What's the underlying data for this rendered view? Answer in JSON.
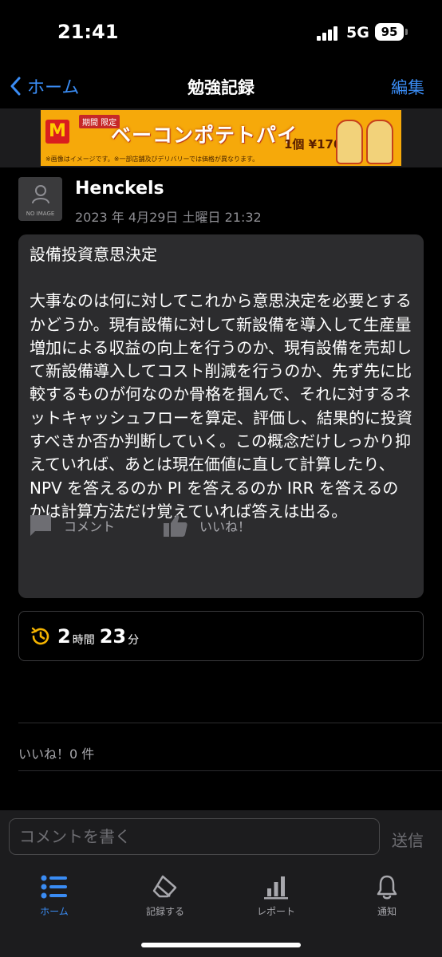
{
  "status_bar": {
    "time": "21:41",
    "network": "5G",
    "battery": "95"
  },
  "nav": {
    "back_label": "ホーム",
    "title": "勉強記録",
    "edit_label": "編集"
  },
  "ad": {
    "brand_mark": "M",
    "tag": "期間 限定",
    "title": "ベーコンポテトパイ",
    "price": "1個 ¥170~",
    "note": "※画像はイメージです。※一部店舗及びデリバリーでは価格が異なります。"
  },
  "post": {
    "avatar_text": "NO IMAGE",
    "username": "Henckels",
    "date": "2023 年 4月29日 土曜日 21:32",
    "title": "設備投資意思決定",
    "body": "大事なのは何に対してこれから意思決定を必要とするかどうか。現有設備に対して新設備を導入して生産量増加による収益の向上を行うのか、現有設備を売却して新設備導入してコスト削減を行うのか、先ず先に比較するものが何なのか骨格を掴んで、それに対するネットキャッシュフローを算定、評価し、結果的に投資すべきか否か判断していく。この概念だけしっかり抑えていれば、あとは現在価値に直して計算したり、NPV を答えるのか PI を答えるのか IRR を答えるのかは計算方法だけ覚えていれば答えは出る。",
    "duration": {
      "hours": "2",
      "hours_unit": "時間",
      "minutes": "23",
      "minutes_unit": "分"
    }
  },
  "actions": {
    "comment_label": "コメント",
    "like_label": "いいね！"
  },
  "likes_count": "いいね！0 件",
  "comment_bar": {
    "placeholder": "コメントを書く",
    "send_label": "送信"
  },
  "tabbar": [
    {
      "label": "ホーム",
      "icon": "list-icon"
    },
    {
      "label": "記録する",
      "icon": "eraser-icon"
    },
    {
      "label": "レポート",
      "icon": "bar-chart-icon"
    },
    {
      "label": "通知",
      "icon": "bell-icon"
    }
  ],
  "colors": {
    "accent": "#3a8cf4",
    "duration_icon": "#f5b400",
    "card_bg": "#2c2c2e"
  }
}
